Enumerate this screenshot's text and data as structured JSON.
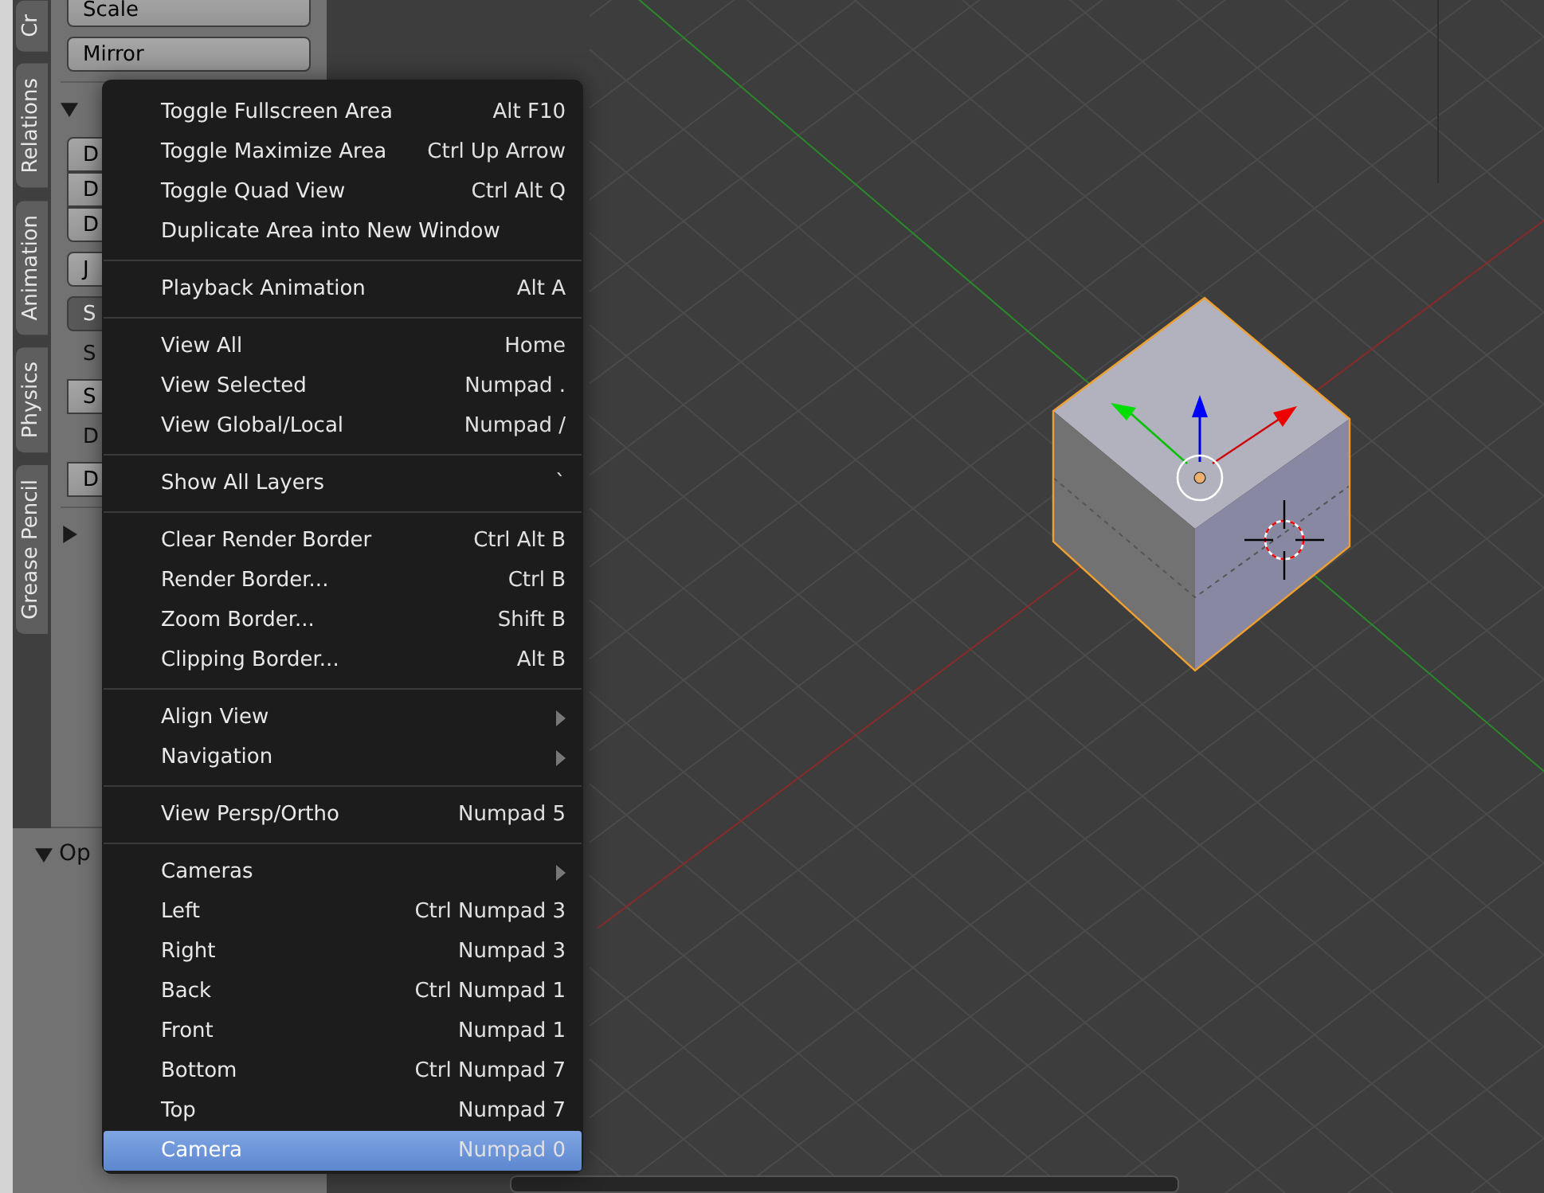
{
  "sidebar_tabs": [
    {
      "label": "Cr"
    },
    {
      "label": "Relations"
    },
    {
      "label": "Animation"
    },
    {
      "label": "Physics"
    },
    {
      "label": "Grease Pencil"
    }
  ],
  "tool_panel": {
    "items": [
      {
        "kind": "button",
        "label": "Scale"
      },
      {
        "kind": "button",
        "label": "Mirror"
      },
      {
        "kind": "header",
        "expanded": true
      },
      {
        "kind": "column",
        "buttons": [
          "D",
          "D",
          "D"
        ]
      },
      {
        "kind": "button",
        "label": "J"
      },
      {
        "kind": "dropdown",
        "label": "S"
      },
      {
        "kind": "label",
        "label": "S"
      },
      {
        "kind": "row",
        "buttons": [
          "S"
        ]
      },
      {
        "kind": "label",
        "label": "D"
      },
      {
        "kind": "row",
        "buttons": [
          "D"
        ]
      },
      {
        "kind": "header",
        "expanded": false
      }
    ],
    "operator": {
      "label": "Op",
      "expanded": true
    }
  },
  "menu": {
    "groups": [
      [
        {
          "label": "Toggle Fullscreen Area",
          "shortcut": "Alt F10",
          "selected": false
        },
        {
          "label": "Toggle Maximize Area",
          "shortcut": "Ctrl Up Arrow",
          "selected": false
        },
        {
          "label": "Toggle Quad View",
          "shortcut": "Ctrl Alt Q",
          "selected": false
        },
        {
          "label": "Duplicate Area into New Window",
          "selected": false
        }
      ],
      [
        {
          "label": "Playback Animation",
          "shortcut": "Alt A",
          "selected": false
        }
      ],
      [
        {
          "label": "View All",
          "shortcut": "Home",
          "selected": false
        },
        {
          "label": "View Selected",
          "shortcut": "Numpad .",
          "selected": false
        },
        {
          "label": "View Global/Local",
          "shortcut": "Numpad /",
          "selected": false
        }
      ],
      [
        {
          "label": "Show All Layers",
          "shortcut": "`",
          "selected": false
        }
      ],
      [
        {
          "label": "Clear Render Border",
          "shortcut": "Ctrl Alt B",
          "selected": false
        },
        {
          "label": "Render Border...",
          "shortcut": "Ctrl B",
          "selected": false
        },
        {
          "label": "Zoom Border...",
          "shortcut": "Shift B",
          "selected": false
        },
        {
          "label": "Clipping Border...",
          "shortcut": "Alt B",
          "selected": false
        }
      ],
      [
        {
          "label": "Align View",
          "submenu": true,
          "selected": false
        },
        {
          "label": "Navigation",
          "submenu": true,
          "selected": false
        }
      ],
      [
        {
          "label": "View Persp/Ortho",
          "shortcut": "Numpad 5",
          "selected": false
        }
      ],
      [
        {
          "label": "Cameras",
          "submenu": true,
          "selected": false
        },
        {
          "label": "Left",
          "shortcut": "Ctrl Numpad 3",
          "selected": false
        },
        {
          "label": "Right",
          "shortcut": "Numpad 3",
          "selected": false
        },
        {
          "label": "Back",
          "shortcut": "Ctrl Numpad 1",
          "selected": false
        },
        {
          "label": "Front",
          "shortcut": "Numpad 1",
          "selected": false
        },
        {
          "label": "Bottom",
          "shortcut": "Ctrl Numpad 7",
          "selected": false
        },
        {
          "label": "Top",
          "shortcut": "Numpad 7",
          "selected": false
        },
        {
          "label": "Camera",
          "shortcut": "Numpad 0",
          "selected": true
        }
      ]
    ]
  }
}
